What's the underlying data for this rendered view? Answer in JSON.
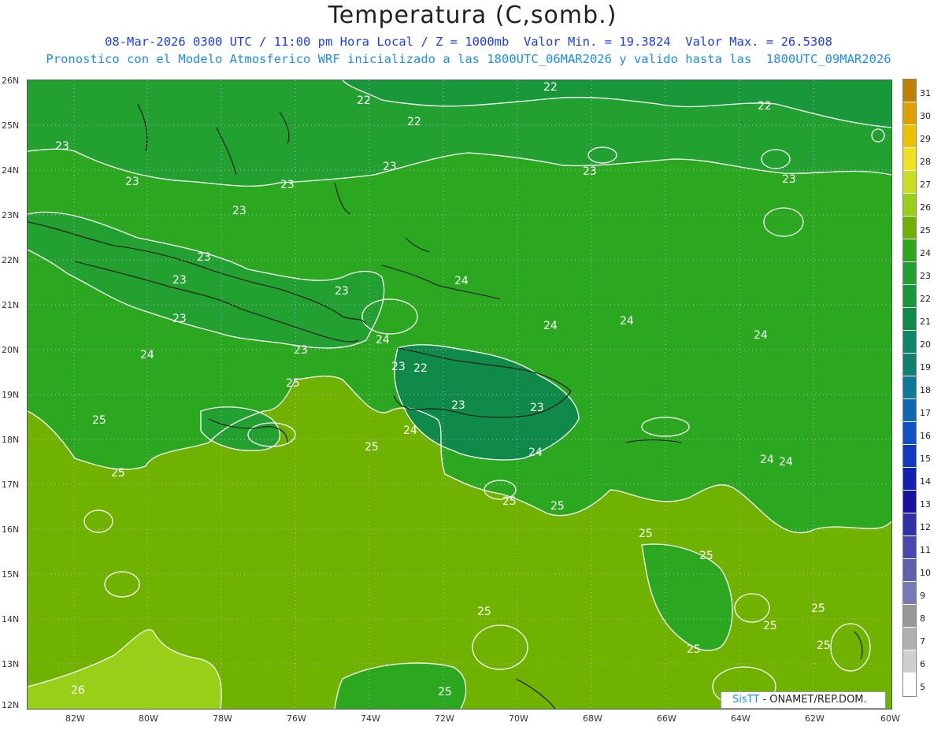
{
  "title": "Temperatura (C,somb.)",
  "subtitle_1": "08-Mar-2026 0300 UTC / 11:00 pm Hora Local / Z = 1000mb  Valor Min. = 19.3824  Valor Max. = 26.5308",
  "subtitle_2": "Pronostico con el Modelo Atmosferico WRF inicializado a las 1800UTC_06MAR2026 y valido hasta las  1800UTC_09MAR2026",
  "credit": {
    "logo": "SisTT",
    "text": "- ONAMET/REP.DOM."
  },
  "lat_labels": [
    "26N",
    "25N",
    "24N",
    "23N",
    "22N",
    "21N",
    "20N",
    "19N",
    "18N",
    "17N",
    "16N",
    "15N",
    "14N",
    "13N",
    "12N"
  ],
  "lon_labels": [
    "82W",
    "80W",
    "78W",
    "76W",
    "74W",
    "72W",
    "70W",
    "68W",
    "66W",
    "64W",
    "62W",
    "60W"
  ],
  "colorbar": {
    "labels": [
      "31",
      "30",
      "29",
      "28",
      "27",
      "26",
      "25",
      "24",
      "23",
      "22",
      "21",
      "20",
      "19",
      "18",
      "17",
      "16",
      "15",
      "14",
      "13",
      "12",
      "11",
      "10",
      "9",
      "8",
      "7",
      "6",
      "5"
    ],
    "colors": [
      "#c08000",
      "#e0a000",
      "#f0c000",
      "#f0e020",
      "#c8e020",
      "#98d018",
      "#70b000",
      "#2ca820",
      "#22a030",
      "#189838",
      "#108a48",
      "#108868",
      "#108070",
      "#107898",
      "#1068b0",
      "#1050c8",
      "#1038c0",
      "#1020b0",
      "#1810a0",
      "#3030a8",
      "#4848b0",
      "#6060b0",
      "#7878b8",
      "#989898",
      "#b0b0b0",
      "#d0d0d0",
      "#ffffff"
    ]
  },
  "contour_labels": [
    {
      "v": "22"
    },
    {
      "v": "22"
    },
    {
      "v": "22"
    },
    {
      "v": "22"
    },
    {
      "v": "23"
    },
    {
      "v": "23"
    },
    {
      "v": "23"
    },
    {
      "v": "23"
    },
    {
      "v": "23"
    },
    {
      "v": "23"
    },
    {
      "v": "23"
    },
    {
      "v": "23"
    },
    {
      "v": "23"
    },
    {
      "v": "23"
    },
    {
      "v": "23"
    },
    {
      "v": "24"
    },
    {
      "v": "24"
    },
    {
      "v": "24"
    },
    {
      "v": "24"
    },
    {
      "v": "24"
    },
    {
      "v": "24"
    },
    {
      "v": "23"
    },
    {
      "v": "22"
    },
    {
      "v": "23"
    },
    {
      "v": "23"
    },
    {
      "v": "24"
    },
    {
      "v": "24"
    },
    {
      "v": "25"
    },
    {
      "v": "25"
    },
    {
      "v": "25"
    },
    {
      "v": "25"
    },
    {
      "v": "25"
    },
    {
      "v": "25"
    },
    {
      "v": "25"
    },
    {
      "v": "25"
    },
    {
      "v": "25"
    },
    {
      "v": "25"
    },
    {
      "v": "25"
    },
    {
      "v": "25"
    },
    {
      "v": "25"
    },
    {
      "v": "26"
    },
    {
      "v": "25"
    },
    {
      "v": "24"
    },
    {
      "v": "24"
    },
    {
      "v": "23"
    }
  ]
}
